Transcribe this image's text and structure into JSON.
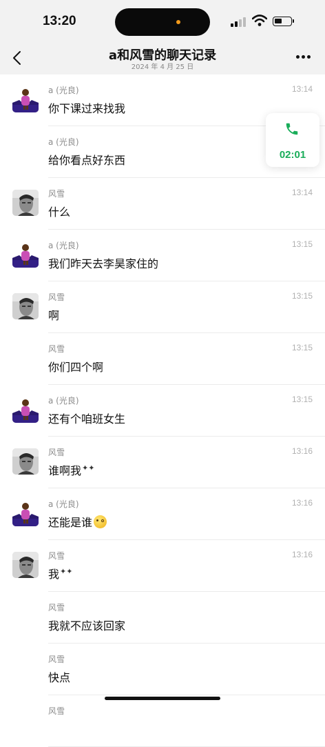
{
  "status": {
    "time": "13:20"
  },
  "header": {
    "title": "a和风雪的聊天记录",
    "subtitle": "2024 年 4 月 25 日"
  },
  "call": {
    "duration": "02:01",
    "accent": "#1aad5a"
  },
  "messages": [
    {
      "sender": "a (光良)",
      "time": "13:14",
      "text": "你下课过来找我",
      "avatar": "a-avatar"
    },
    {
      "sender": "a (光良)",
      "time": "",
      "text": "给你看点好东西",
      "avatar": ""
    },
    {
      "sender": "风雪",
      "time": "13:14",
      "text": "什么",
      "avatar": "fengxue-avatar"
    },
    {
      "sender": "a (光良)",
      "time": "13:15",
      "text": "我们昨天去李昊家住的",
      "avatar": "a-avatar"
    },
    {
      "sender": "风雪",
      "time": "13:15",
      "text": "啊",
      "avatar": "fengxue-avatar"
    },
    {
      "sender": "风雪",
      "time": "13:15",
      "text": "你们四个啊",
      "avatar": ""
    },
    {
      "sender": "a (光良)",
      "time": "13:15",
      "text": "还有个咱班女生",
      "avatar": "a-avatar"
    },
    {
      "sender": "风雪",
      "time": "13:16",
      "text": "谁啊我",
      "avatar": "fengxue-avatar",
      "sparkle": "✦✦"
    },
    {
      "sender": "a (光良)",
      "time": "13:16",
      "text": "还能是谁",
      "avatar": "a-avatar",
      "emoji": "flushed-emoji"
    },
    {
      "sender": "风雪",
      "time": "13:16",
      "text": "我",
      "avatar": "fengxue-avatar",
      "sparkle": "✦✦"
    },
    {
      "sender": "风雪",
      "time": "",
      "text": "我就不应该回家",
      "avatar": ""
    },
    {
      "sender": "风雪",
      "time": "",
      "text": "快点",
      "avatar": ""
    },
    {
      "sender": "风雪",
      "time": "",
      "text": "",
      "avatar": ""
    }
  ]
}
